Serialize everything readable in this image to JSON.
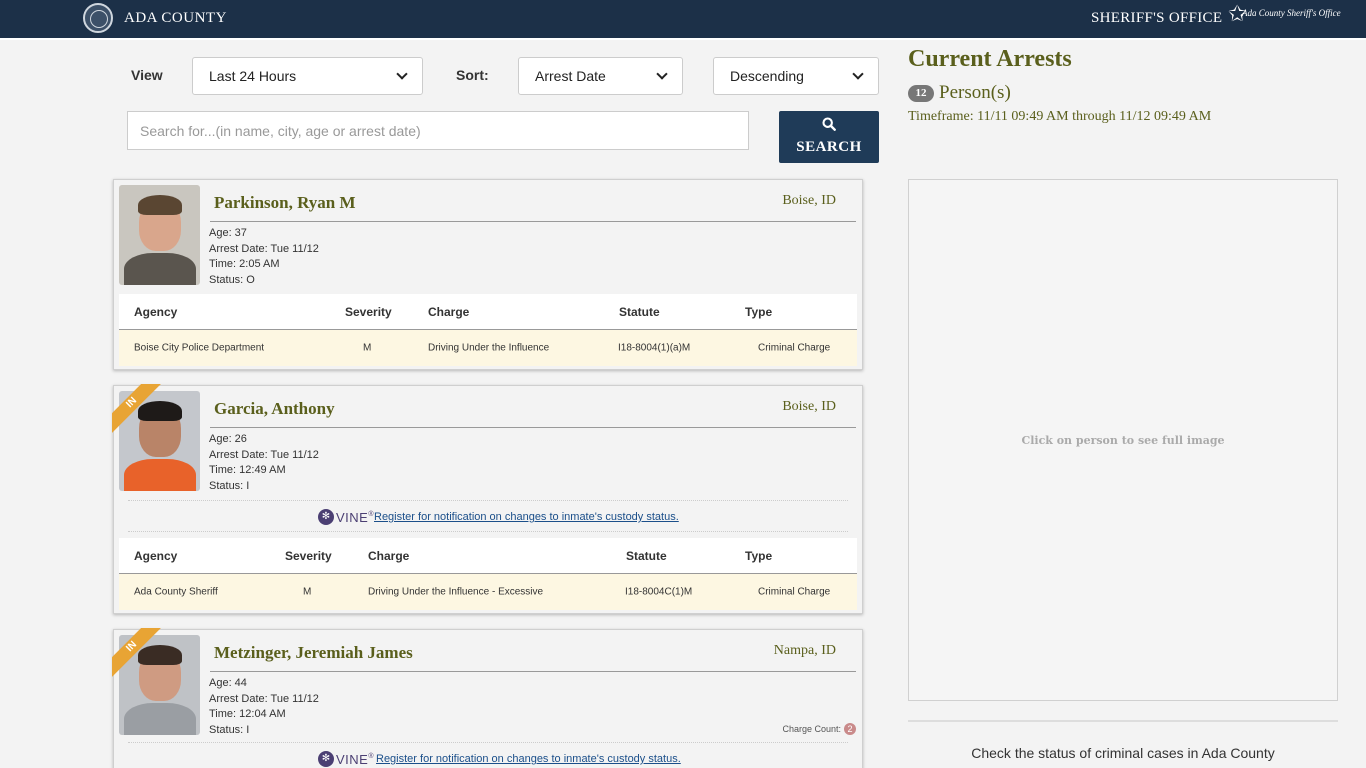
{
  "header": {
    "county_name": "ADA COUNTY",
    "office_name": "SHERIFF'S OFFICE",
    "office_logo_text": "Ada County Sheriff's Office",
    "seal_icon": "county-seal-icon",
    "star_icon": "sheriff-star-icon"
  },
  "filters": {
    "view_label": "View",
    "view_value": "Last 24 Hours",
    "sort_label": "Sort:",
    "sort_value": "Arrest Date",
    "order_value": "Descending",
    "search_placeholder": "Search for...(in name, city, age or arrest date)",
    "search_button": "SEARCH"
  },
  "charge_headers": {
    "agency": "Agency",
    "severity": "Severity",
    "charge": "Charge",
    "statute": "Statute",
    "type": "Type"
  },
  "vine": {
    "logo_text": "VINE",
    "link_text": " Register for notification on changes to inmate's custody status."
  },
  "arrests": [
    {
      "name": "Parkinson, Ryan M",
      "city": "Boise, ID",
      "age": "Age: 37",
      "arrest_date": "Arrest Date: Tue 11/12",
      "time": "Time: 2:05 AM",
      "status": "Status: O",
      "in_custody": false,
      "charges": [
        {
          "agency": "Boise City Police Department",
          "severity": "M",
          "charge": "Driving Under the Influence",
          "statute": "I18-8004(1)(a)M",
          "type": "Criminal Charge"
        }
      ]
    },
    {
      "name": "Garcia, Anthony",
      "city": "Boise, ID",
      "age": "Age: 26",
      "arrest_date": "Arrest Date: Tue 11/12",
      "time": "Time: 12:49 AM",
      "status": "Status: I",
      "in_custody": true,
      "ribbon": "IN",
      "charges": [
        {
          "agency": "Ada County Sheriff",
          "severity": "M",
          "charge": "Driving Under the Influence - Excessive",
          "statute": "I18-8004C(1)M",
          "type": "Criminal Charge"
        }
      ]
    },
    {
      "name": "Metzinger, Jeremiah James",
      "city": "Nampa, ID",
      "age": "Age: 44",
      "arrest_date": "Arrest Date: Tue 11/12",
      "time": "Time: 12:04 AM",
      "status": "Status: I",
      "in_custody": true,
      "ribbon": "IN",
      "charge_count_label": "Charge Count:",
      "charge_count": "2"
    }
  ],
  "right_panel": {
    "title": "Current Arrests",
    "person_count": "12",
    "person_label": "Person(s)",
    "timeframe": "Timeframe: 11/11 09:49 AM through 11/12 09:49 AM",
    "image_hint": "Click on person to see full image",
    "cases_text": "Check the status of criminal cases in Ada County"
  },
  "colors": {
    "header_bg": "#1c3048",
    "accent_olive": "#5a5f1c",
    "search_button_bg": "#1f3b58",
    "ribbon": "#e8a434",
    "charge_row_bg": "#fdf7e2",
    "vine_purple": "#4b3f73"
  }
}
